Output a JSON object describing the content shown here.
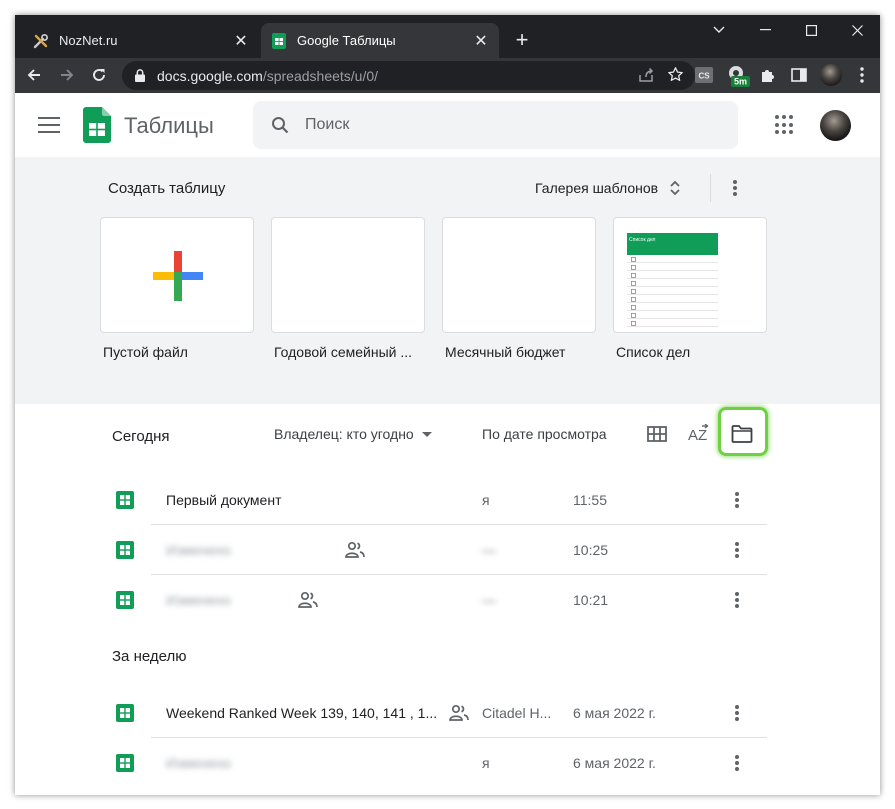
{
  "browser": {
    "tabs": [
      {
        "title": "NozNet.ru",
        "active": false,
        "icon": "tools-icon"
      },
      {
        "title": "Google Таблицы",
        "active": true,
        "icon": "google-sheets-icon"
      }
    ],
    "url_host": "docs.google.com",
    "url_path": "/spreadsheets/u/0/",
    "extension_badge": "5m",
    "extension_cs_label": "CS"
  },
  "app": {
    "title": "Таблицы",
    "search_placeholder": "Поиск"
  },
  "gallery": {
    "title": "Создать таблицу",
    "gallery_link": "Галерея шаблонов",
    "templates": [
      {
        "label": "Пустой файл"
      },
      {
        "label": "Годовой семейный ..."
      },
      {
        "label": "Месячный бюджет"
      },
      {
        "label": "Список дел",
        "preview_title": "Список дел"
      }
    ]
  },
  "list": {
    "owner_filter": "Владелец: кто угодно",
    "sort_label": "По дате просмотра",
    "sort_icon_label": "AZ",
    "sections": [
      {
        "title": "Сегодня",
        "files": [
          {
            "name": "Первый документ",
            "owner": "я",
            "date": "11:55",
            "shared": false
          },
          {
            "name": "Изменено",
            "owner": "—",
            "date": "10:25",
            "shared": true
          },
          {
            "name": "Изменено",
            "owner": "—",
            "date": "10:21",
            "shared": true
          }
        ]
      },
      {
        "title": "За неделю",
        "files": [
          {
            "name": "Weekend Ranked Week 139, 140, 141 , 1...",
            "owner": "Citadel H...",
            "date": "6 мая 2022 г.",
            "shared": true
          },
          {
            "name": "Изменено",
            "owner": "я",
            "date": "6 мая 2022 г.",
            "shared": false
          }
        ]
      }
    ]
  },
  "colors": {
    "sheets_green": "#0f9d58",
    "highlight": "#70d044",
    "chrome_dark": "#202124",
    "chrome_toolbar": "#35363a"
  }
}
